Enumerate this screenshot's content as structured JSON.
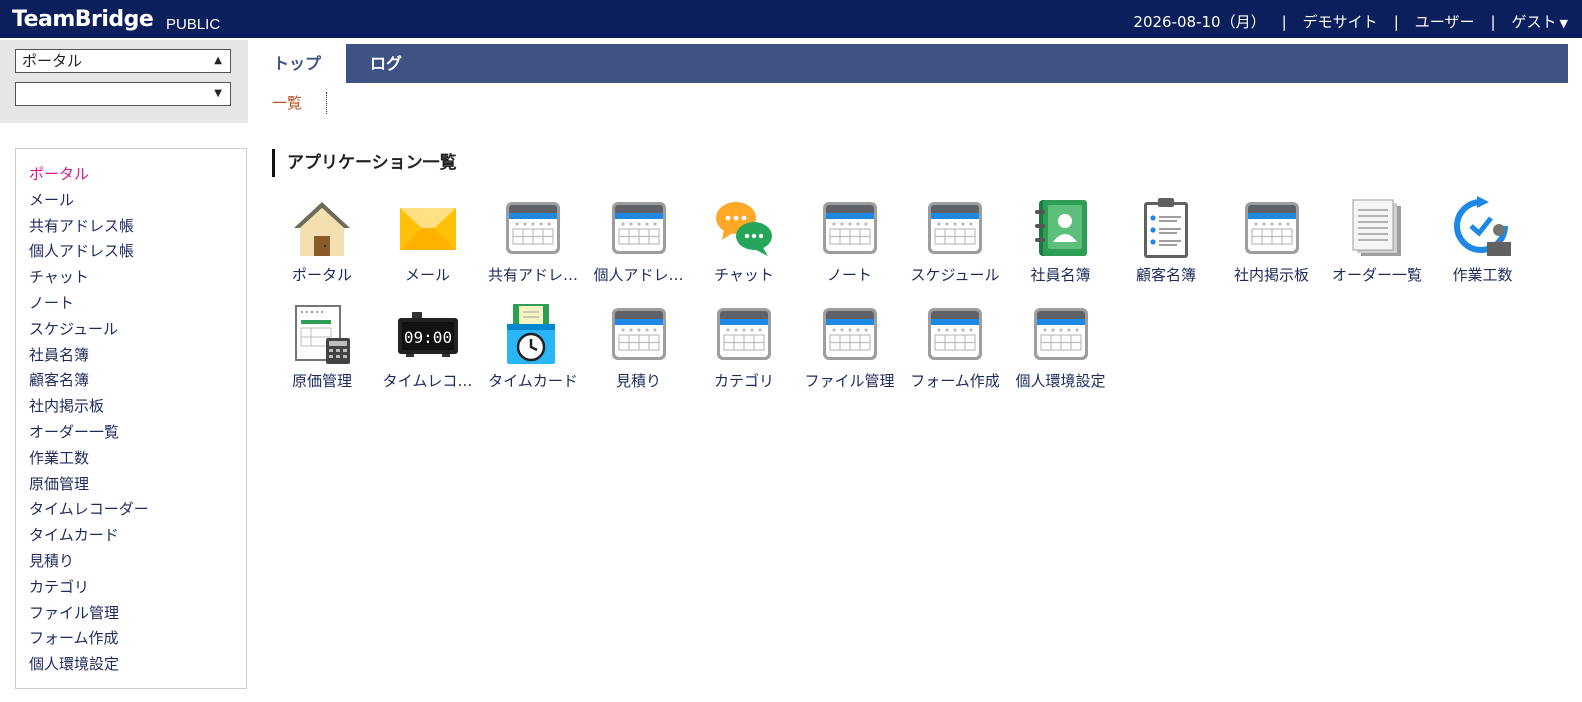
{
  "header": {
    "brand": "TeamBridge",
    "brand_sub": "PUBLIC",
    "date": "2026-08-10（月）",
    "demo_site": "デモサイト",
    "user_menu": "ユーザー",
    "guest_menu": "ゲスト",
    "separator": "|"
  },
  "selectors": {
    "primary": "ポータル",
    "secondary": ""
  },
  "tabs": [
    "トップ",
    "ログ"
  ],
  "subnav": {
    "list": "一覧"
  },
  "sidebar": {
    "items": [
      "ポータル",
      "メール",
      "共有アドレス帳",
      "個人アドレス帳",
      "チャット",
      "ノート",
      "スケジュール",
      "社員名簿",
      "顧客名簿",
      "社内掲示板",
      "オーダー一覧",
      "作業工数",
      "原価管理",
      "タイムレコーダー",
      "タイムカード",
      "見積り",
      "カテゴリ",
      "ファイル管理",
      "フォーム作成",
      "個人環境設定"
    ]
  },
  "main": {
    "title": "アプリケーション一覧",
    "apps": [
      {
        "label": "ポータル",
        "icon": "house-icon"
      },
      {
        "label": "メール",
        "icon": "envelope-icon"
      },
      {
        "label": "共有アドレ…",
        "icon": "calendar-grid-icon"
      },
      {
        "label": "個人アドレ…",
        "icon": "calendar-grid-icon"
      },
      {
        "label": "チャット",
        "icon": "chat-bubbles-icon"
      },
      {
        "label": "ノート",
        "icon": "calendar-grid-icon"
      },
      {
        "label": "スケジュール",
        "icon": "calendar-grid-icon"
      },
      {
        "label": "社員名簿",
        "icon": "contact-book-icon"
      },
      {
        "label": "顧客名簿",
        "icon": "clipboard-list-icon"
      },
      {
        "label": "社内掲示板",
        "icon": "calendar-grid-icon"
      },
      {
        "label": "オーダー一覧",
        "icon": "document-stack-icon"
      },
      {
        "label": "作業工数",
        "icon": "worker-clock-icon"
      },
      {
        "label": "原価管理",
        "icon": "spreadsheet-calculator-icon"
      },
      {
        "label": "タイムレコ…",
        "icon": "digital-clock-icon",
        "clock_text": "09:00"
      },
      {
        "label": "タイムカード",
        "icon": "time-card-icon"
      },
      {
        "label": "見積り",
        "icon": "calendar-grid-icon"
      },
      {
        "label": "カテゴリ",
        "icon": "calendar-grid-icon"
      },
      {
        "label": "ファイル管理",
        "icon": "calendar-grid-icon"
      },
      {
        "label": "フォーム作成",
        "icon": "calendar-grid-icon"
      },
      {
        "label": "個人環境設定",
        "icon": "calendar-grid-icon"
      }
    ]
  },
  "colors": {
    "header_bg": "#0b1f5c",
    "tab_bar_bg": "#3e5283",
    "sidebar_active": "#e0198d",
    "link_text": "#1d2b5c",
    "subnav_text": "#b5531e",
    "calendar_blue": "#1e88e5",
    "contact_green": "#2e9d55"
  }
}
